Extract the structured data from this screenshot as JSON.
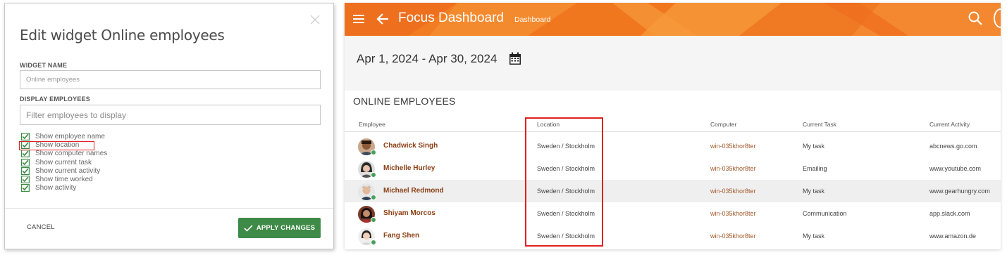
{
  "dialog": {
    "title": "Edit widget Online employees",
    "widget_name_label": "WIDGET NAME",
    "widget_name_placeholder": "Online employees",
    "display_employees_label": "DISPLAY EMPLOYEES",
    "filter_placeholder": "Filter employees to display",
    "options": [
      {
        "label": "Show employee name",
        "checked": true
      },
      {
        "label": "Show location",
        "checked": true
      },
      {
        "label": "Show computer names",
        "checked": true
      },
      {
        "label": "Show current task",
        "checked": true
      },
      {
        "label": "Show current activity",
        "checked": true
      },
      {
        "label": "Show time worked",
        "checked": true
      },
      {
        "label": "Show activity",
        "checked": true
      }
    ],
    "cancel_label": "CANCEL",
    "apply_label": "APPLY CHANGES"
  },
  "dashboard": {
    "app_title": "Focus Dashboard",
    "app_subtitle": "Dashboard",
    "date_range": "Apr 1, 2024 - Apr 30, 2024",
    "section_title": "ONLINE EMPLOYEES",
    "columns": [
      "Employee",
      "Location",
      "Computer",
      "Current Task",
      "Current Activity"
    ],
    "rows": [
      {
        "name": "Chadwick Singh",
        "location": "Sweden / Stockholm",
        "computer": "win-035khor8ter",
        "task": "My task",
        "activity": "abcnews.go.com"
      },
      {
        "name": "Michelle Hurley",
        "location": "Sweden / Stockholm",
        "computer": "win-035khor8ter",
        "task": "Emailing",
        "activity": "www.youtube.com"
      },
      {
        "name": "Michael Redmond",
        "location": "Sweden / Stockholm",
        "computer": "win-035khor8ter",
        "task": "My task",
        "activity": "www.gearhungry.com"
      },
      {
        "name": "Shiyam Morcos",
        "location": "Sweden / Stockholm",
        "computer": "win-035khor8ter",
        "task": "Communication",
        "activity": "app.slack.com"
      },
      {
        "name": "Fang Shen",
        "location": "Sweden / Stockholm",
        "computer": "win-035khor8ter",
        "task": "My task",
        "activity": "www.amazon.de"
      }
    ]
  },
  "colors": {
    "app_bar": "#f27c22",
    "apply_button": "#3e8a47",
    "employee_name": "#8b3f14",
    "online_dot": "#45a05a",
    "highlight": "#e02020"
  }
}
